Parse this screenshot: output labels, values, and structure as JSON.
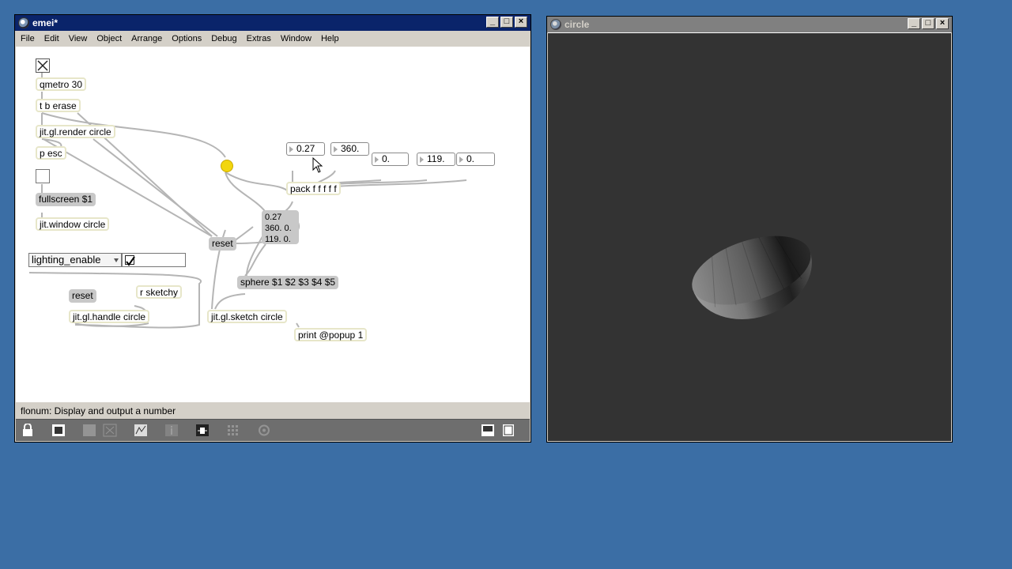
{
  "patcher_window": {
    "title": "emei*",
    "menu": [
      "File",
      "Edit",
      "View",
      "Object",
      "Arrange",
      "Options",
      "Debug",
      "Extras",
      "Window",
      "Help"
    ],
    "status": "flonum: Display and output a number",
    "objects": {
      "qmetro": "qmetro 30",
      "tberase": "t b erase",
      "render": "jit.gl.render circle",
      "pesc": "p esc",
      "fullscreen": "fullscreen $1",
      "window": "jit.window circle",
      "lighting_menu": "lighting_enable",
      "reset1": "reset",
      "rsketchy": "r sketchy",
      "reset2": "reset",
      "handle": "jit.gl.handle circle",
      "sketch": "jit.gl.sketch circle",
      "print": "print @popup 1",
      "pack": "pack f f f f f",
      "sphere": "sphere $1 $2 $3 $4 $5",
      "msgbox_line1": "0.27",
      "msgbox_line2": "360. 0.",
      "msgbox_line3": "119. 0."
    },
    "numbers": {
      "n1": "0.27",
      "n2": "360.",
      "n3": "0.",
      "n4": "119.",
      "n5": "0."
    },
    "toggle_checked": true
  },
  "render_window": {
    "title": "circle"
  },
  "colors": {
    "desktop": "#3b6ea5",
    "title_active": "#0a246a",
    "title_inactive": "#808080",
    "bang": "#f2d60e",
    "gl_background": "#333333"
  },
  "icons": [
    "lock-icon",
    "presentation-icon",
    "toggle-grid-icon",
    "inspector-icon",
    "debug-icon",
    "info-icon",
    "slider-icon",
    "grid-icon",
    "settings-icon",
    "split-view-icon",
    "sidebar-icon"
  ]
}
